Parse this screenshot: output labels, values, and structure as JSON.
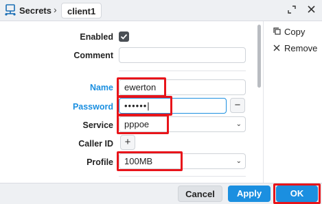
{
  "header": {
    "breadcrumb_root": "Secrets",
    "breadcrumb_separator": "›",
    "tab_label": "client1",
    "expand_icon": "expand-icon",
    "close_icon": "close-icon"
  },
  "form": {
    "enabled": {
      "label": "Enabled",
      "checked": true
    },
    "comment": {
      "label": "Comment",
      "value": ""
    },
    "name": {
      "label": "Name",
      "value": "ewerton"
    },
    "password": {
      "label": "Password",
      "value": "••••••|",
      "minus_label": "−"
    },
    "service": {
      "label": "Service",
      "value": "pppoe"
    },
    "caller_id": {
      "label": "Caller ID",
      "add_label": "+"
    },
    "profile": {
      "label": "Profile",
      "value": "100MB"
    }
  },
  "side_panel": {
    "copy_label": "Copy",
    "remove_label": "Remove"
  },
  "footer": {
    "cancel_label": "Cancel",
    "apply_label": "Apply",
    "ok_label": "OK"
  },
  "colors": {
    "accent": "#1b8fe0",
    "highlight": "#e8141a",
    "panel_bg": "#eef0f3"
  }
}
